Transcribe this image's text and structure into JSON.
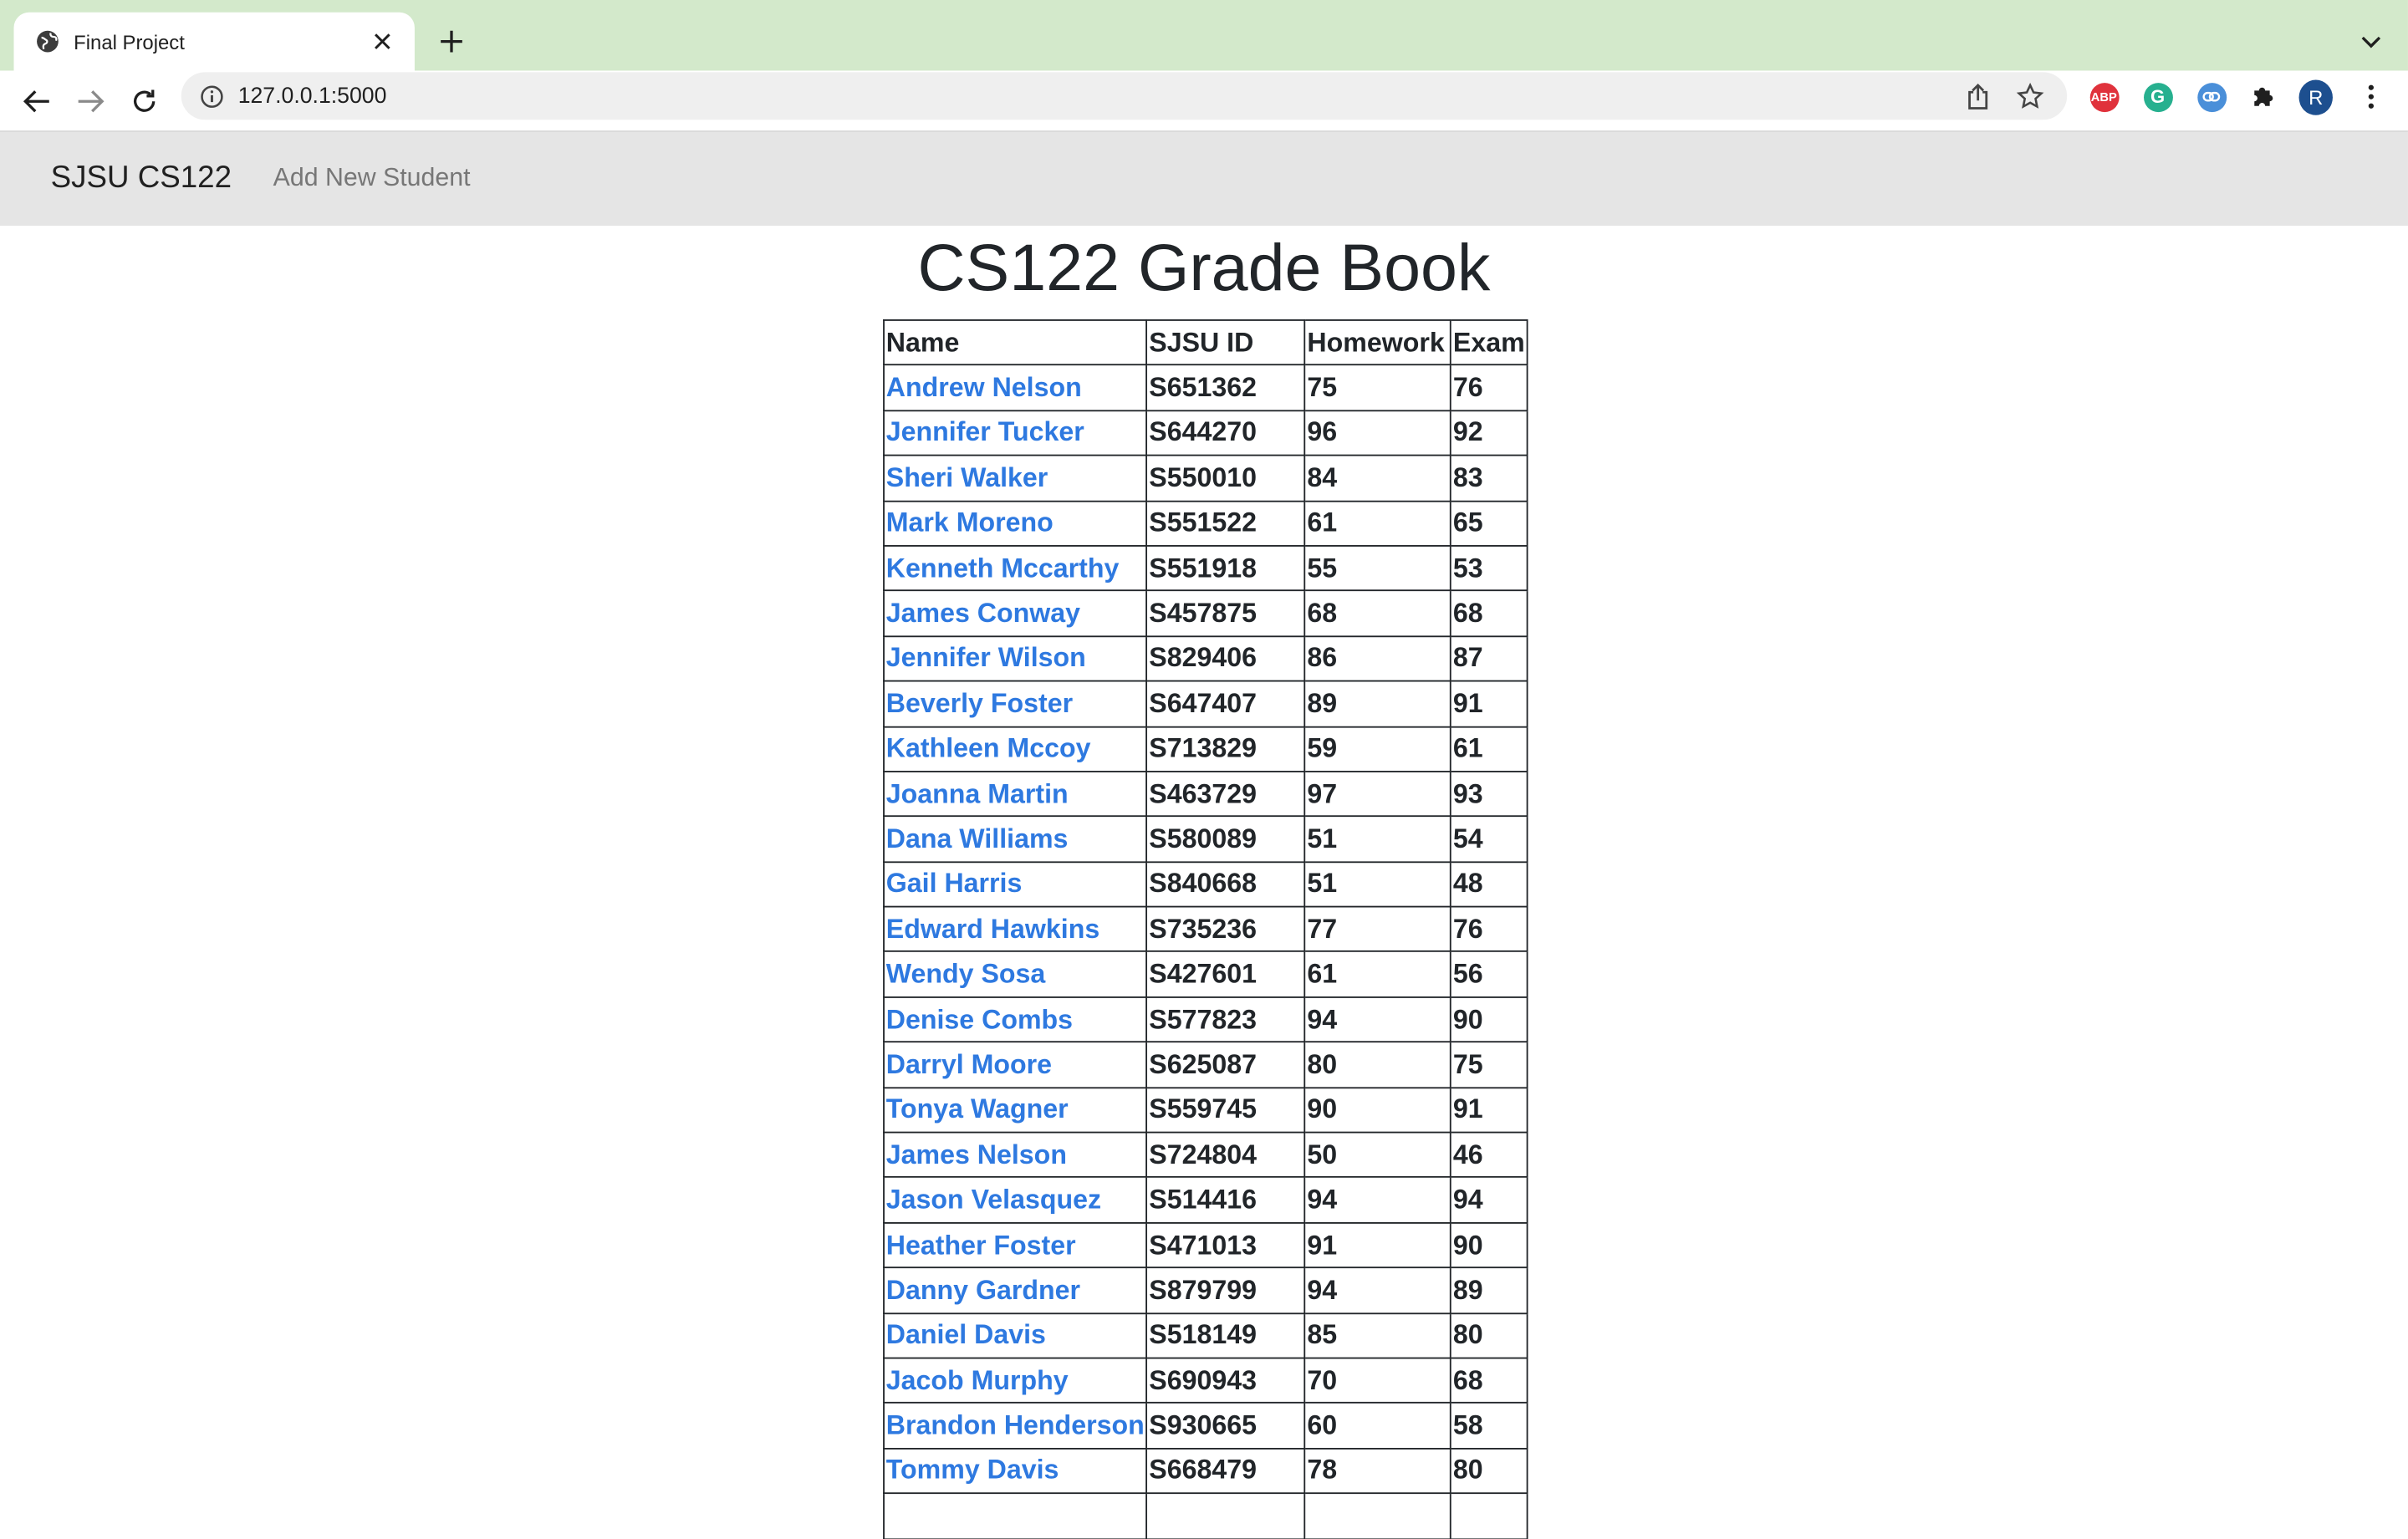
{
  "browser": {
    "tab_title": "Final Project",
    "url": "127.0.0.1:5000",
    "profile_initial": "R",
    "extensions": [
      "adblock-plus",
      "grammarly",
      "link",
      "puzzle"
    ]
  },
  "navbar": {
    "brand": "SJSU CS122",
    "link": "Add New Student"
  },
  "page": {
    "title": "CS122 Grade Book"
  },
  "table": {
    "headers": [
      "Name",
      "SJSU ID",
      "Homework",
      "Exam"
    ],
    "rows": [
      [
        "Andrew Nelson",
        "S651362",
        "75",
        "76"
      ],
      [
        "Jennifer Tucker",
        "S644270",
        "96",
        "92"
      ],
      [
        "Sheri Walker",
        "S550010",
        "84",
        "83"
      ],
      [
        "Mark Moreno",
        "S551522",
        "61",
        "65"
      ],
      [
        "Kenneth Mccarthy",
        "S551918",
        "55",
        "53"
      ],
      [
        "James Conway",
        "S457875",
        "68",
        "68"
      ],
      [
        "Jennifer Wilson",
        "S829406",
        "86",
        "87"
      ],
      [
        "Beverly Foster",
        "S647407",
        "89",
        "91"
      ],
      [
        "Kathleen Mccoy",
        "S713829",
        "59",
        "61"
      ],
      [
        "Joanna Martin",
        "S463729",
        "97",
        "93"
      ],
      [
        "Dana Williams",
        "S580089",
        "51",
        "54"
      ],
      [
        "Gail Harris",
        "S840668",
        "51",
        "48"
      ],
      [
        "Edward Hawkins",
        "S735236",
        "77",
        "76"
      ],
      [
        "Wendy Sosa",
        "S427601",
        "61",
        "56"
      ],
      [
        "Denise Combs",
        "S577823",
        "94",
        "90"
      ],
      [
        "Darryl Moore",
        "S625087",
        "80",
        "75"
      ],
      [
        "Tonya Wagner",
        "S559745",
        "90",
        "91"
      ],
      [
        "James Nelson",
        "S724804",
        "50",
        "46"
      ],
      [
        "Jason Velasquez",
        "S514416",
        "94",
        "94"
      ],
      [
        "Heather Foster",
        "S471013",
        "91",
        "90"
      ],
      [
        "Danny Gardner",
        "S879799",
        "94",
        "89"
      ],
      [
        "Daniel Davis",
        "S518149",
        "85",
        "80"
      ],
      [
        "Jacob Murphy",
        "S690943",
        "70",
        "68"
      ],
      [
        "Brandon Henderson",
        "S930665",
        "60",
        "58"
      ],
      [
        "Tommy Davis",
        "S668479",
        "78",
        "80"
      ],
      [
        "",
        "",
        "",
        ""
      ]
    ]
  }
}
